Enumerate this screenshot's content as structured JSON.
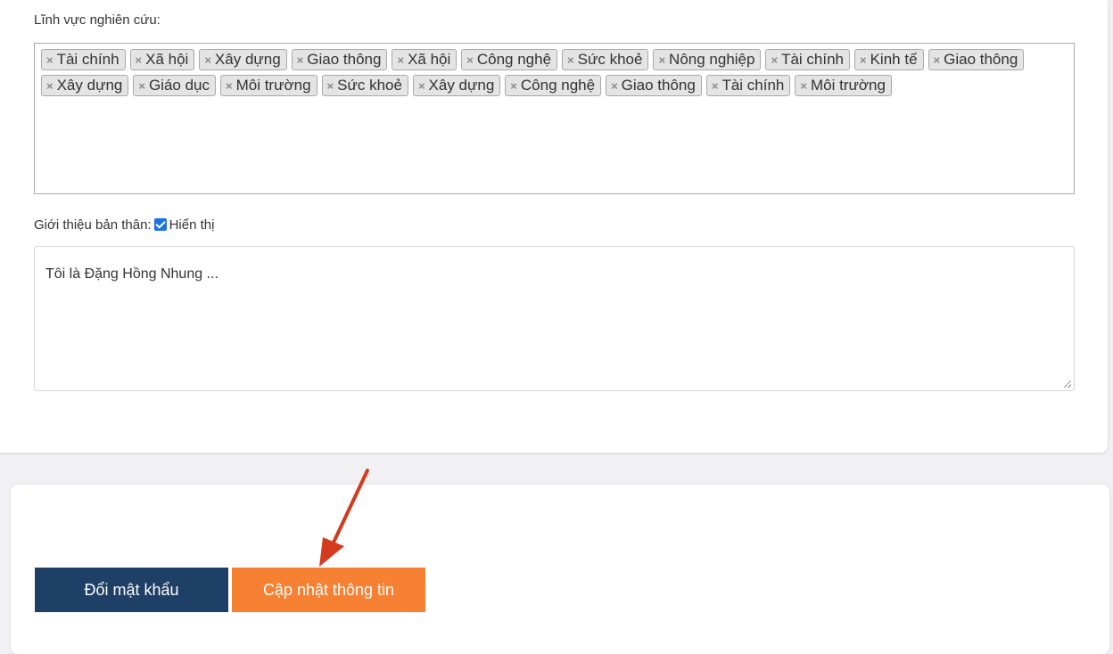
{
  "research": {
    "label": "Lĩnh vực nghiên cứu:",
    "tags": [
      "Tài chính",
      "Xã hội",
      "Xây dựng",
      "Giao thông",
      "Xã hội",
      "Công nghệ",
      "Sức khoẻ",
      "Nông nghiệp",
      "Tài chính",
      "Kinh tế",
      "Giao thông",
      "Xây dựng",
      "Giáo dục",
      "Môi trường",
      "Sức khoẻ",
      "Xây dựng",
      "Công nghệ",
      "Giao thông",
      "Tài chính",
      "Môi trường"
    ],
    "remove_glyph": "×"
  },
  "bio": {
    "label": "Giới thiệu bản thân:",
    "display_checkbox_checked": true,
    "display_label": "Hiển thị",
    "value": "Tôi là Đặng Hồng Nhung ..."
  },
  "actions": {
    "change_password_label": "Đổi mật khẩu",
    "update_info_label": "Cập nhật thông tin"
  },
  "colors": {
    "primary_button": "#1e3f66",
    "update_button": "#f78132",
    "annotation_arrow": "#d33a1f",
    "checkbox": "#1a73e8"
  }
}
